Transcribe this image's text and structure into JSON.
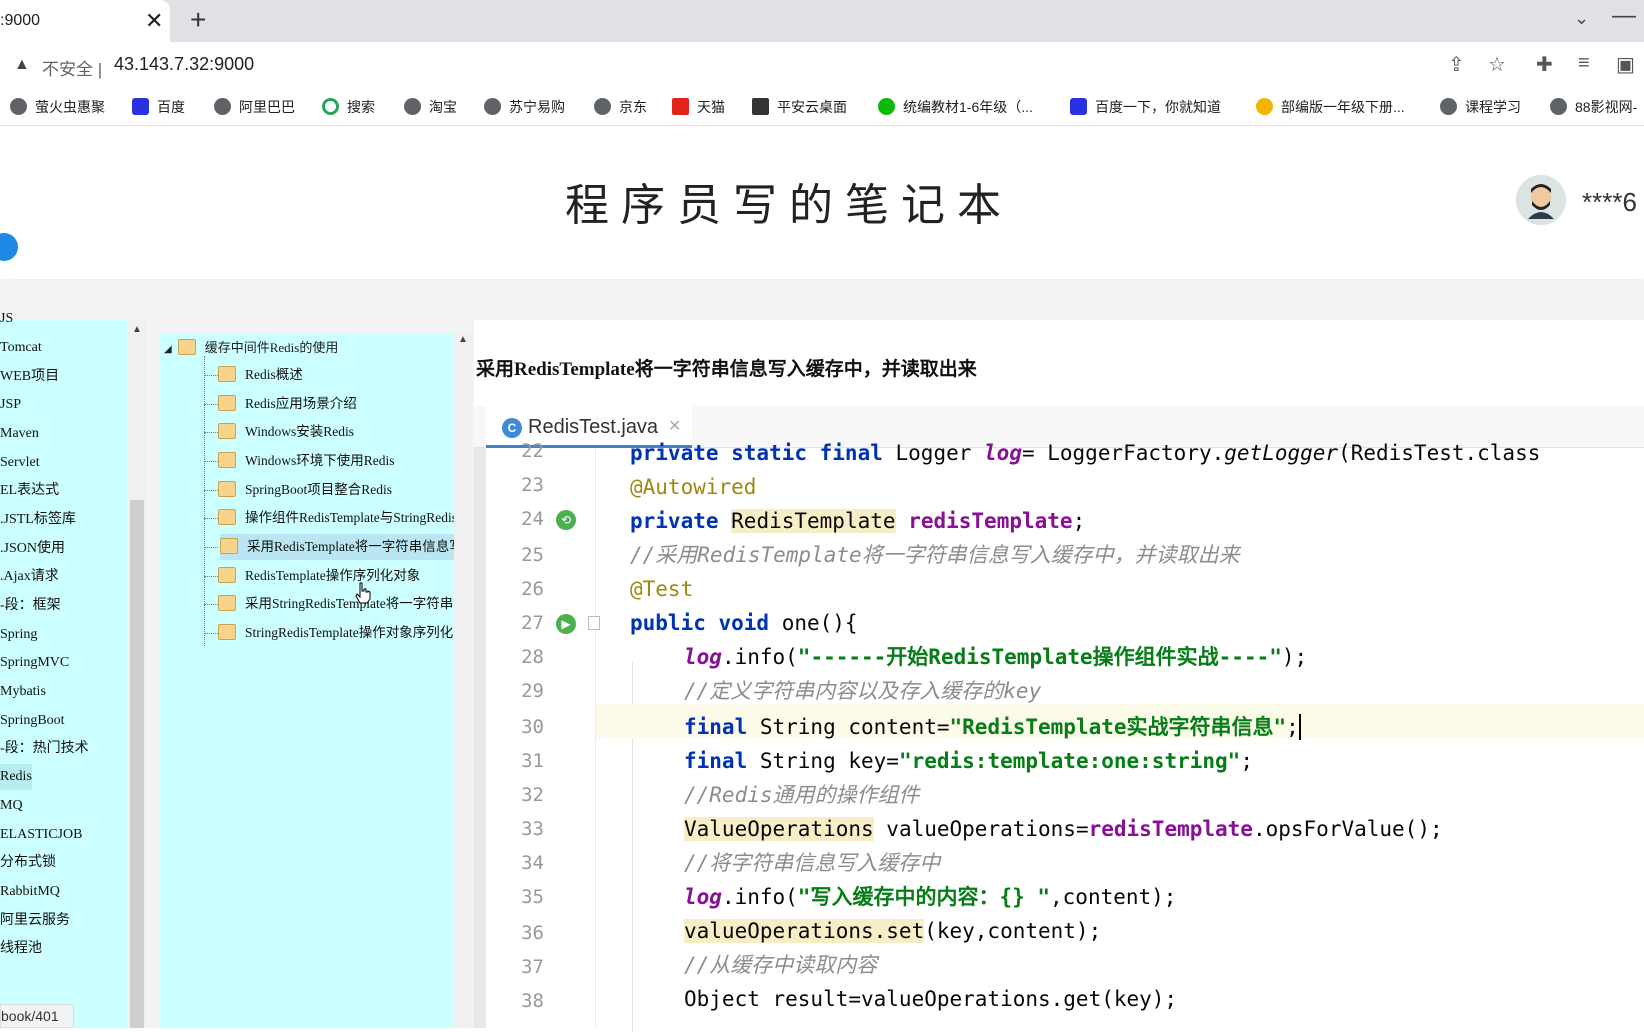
{
  "browser": {
    "tab_title": ":9000",
    "tab_close": "✕",
    "new_tab": "+",
    "tab_menu": "⌄",
    "minimize": "—",
    "insecure_label": "不安全 |",
    "url": "43.143.7.32:9000"
  },
  "bookmarks": [
    {
      "label": "萤火虫惠聚",
      "icon": "globe-icon",
      "color": "#5f6368"
    },
    {
      "label": "百度",
      "icon": "baidu-icon",
      "color": "#2932e1"
    },
    {
      "label": "阿里巴巴",
      "icon": "globe-icon",
      "color": "#5f6368"
    },
    {
      "label": "搜索",
      "icon": "search-o-icon",
      "color": "#22a75b"
    },
    {
      "label": "淘宝",
      "icon": "globe-icon",
      "color": "#5f6368"
    },
    {
      "label": "苏宁易购",
      "icon": "globe-icon",
      "color": "#5f6368"
    },
    {
      "label": "京东",
      "icon": "globe-icon",
      "color": "#5f6368"
    },
    {
      "label": "天猫",
      "icon": "tmall-icon",
      "color": "#e1251b"
    },
    {
      "label": "平安云桌面",
      "icon": "pingan-icon",
      "color": "#333333"
    },
    {
      "label": "统编教材1-6年级（...",
      "icon": "wechat-icon",
      "color": "#09bb07"
    },
    {
      "label": "百度一下，你就知道",
      "icon": "baidu-icon",
      "color": "#2932e1"
    },
    {
      "label": "部编版一年级下册...",
      "icon": "emoji-icon",
      "color": "#f2b600"
    },
    {
      "label": "课程学习",
      "icon": "globe-icon",
      "color": "#5f6368"
    },
    {
      "label": "88影视网-",
      "icon": "globe-icon",
      "color": "#5f6368"
    }
  ],
  "header": {
    "site_title": "程序员写的笔记本",
    "username": "****6"
  },
  "left_nav": [
    "JS",
    "Tomcat",
    "WEB项目",
    "JSP",
    "Maven",
    "Servlet",
    "EL表达式",
    ".JSTL标签库",
    ".JSON使用",
    ".Ajax请求",
    "-段：框架",
    "Spring",
    "SpringMVC",
    "Mybatis",
    "SpringBoot",
    "-段：热门技术",
    "Redis",
    "MQ",
    "ELASTICJOB",
    "分布式锁",
    "RabbitMQ",
    "阿里云服务",
    "线程池"
  ],
  "tree": {
    "root": "缓存中间件Redis的使用",
    "items": [
      "Redis概述",
      "Redis应用场景介绍",
      "Windows安装Redis",
      "Windows环境下使用Redis",
      "SpringBoot项目整合Redis",
      "操作组件RedisTemplate与StringRedisTemplate",
      "采用RedisTemplate将一字符串信息写入缓存中",
      "RedisTemplate操作序列化对象",
      "采用StringRedisTemplate将一字符串信息写入缓存中",
      "StringRedisTemplate操作对象序列化"
    ]
  },
  "article": {
    "title": "采用RedisTemplate将一字符串信息写入缓存中，并读取出来"
  },
  "ide": {
    "java_icon": "C",
    "tab_name": "RedisTest.java",
    "tab_close": "✕",
    "line_numbers": [
      "22",
      "23",
      "24",
      "25",
      "26",
      "27",
      "28",
      "29",
      "30",
      "31",
      "32",
      "33",
      "34",
      "35",
      "36",
      "37",
      "38"
    ],
    "code": {
      "l22_kw": "private static final ",
      "l22_type": "Logger ",
      "l22_log": "log",
      "l22_rest": "= LoggerFactory.",
      "l22_get": "getLogger",
      "l22_end": "(RedisTest.class",
      "l23": "@Autowired",
      "l24_kw": "private ",
      "l24_type": "RedisTemplate",
      "l24_sp": " ",
      "l24_fld": "redisTemplate",
      "l24_end": ";",
      "l25": "//采用RedisTemplate将一字符串信息写入缓存中，并读取出来",
      "l26": "@Test",
      "l27_kw": "public void ",
      "l27_rest": "one(){",
      "l28_log": "log",
      "l28_mid": ".info(",
      "l28_str": "\"------开始RedisTemplate操作组件实战----\"",
      "l28_end": ");",
      "l29": "//定义字符串内容以及存入缓存的key",
      "l30_kw": "final ",
      "l30_mid": "String content=",
      "l30_str": "\"RedisTemplate实战字符串信息\"",
      "l30_end": ";",
      "l31_kw": "final ",
      "l31_mid": "String key=",
      "l31_str": "\"redis:template:one:string\"",
      "l31_end": ";",
      "l32": "//Redis通用的操作组件",
      "l33_type": "ValueOperations",
      "l33_mid": " valueOperations=",
      "l33_fld": "redisTemplate",
      "l33_end": ".opsForValue();",
      "l34": "//将字符串信息写入缓存中",
      "l35_log": "log",
      "l35_mid": ".info(",
      "l35_str": "\"写入缓存中的内容：{} \"",
      "l35_end": ",content);",
      "l36_hl": "valueOperations.set",
      "l36_end": "(key,content);",
      "l37": "//从缓存中读取内容",
      "l38": "Object result=valueOperations.get(key);"
    }
  },
  "status_url": "book/401"
}
